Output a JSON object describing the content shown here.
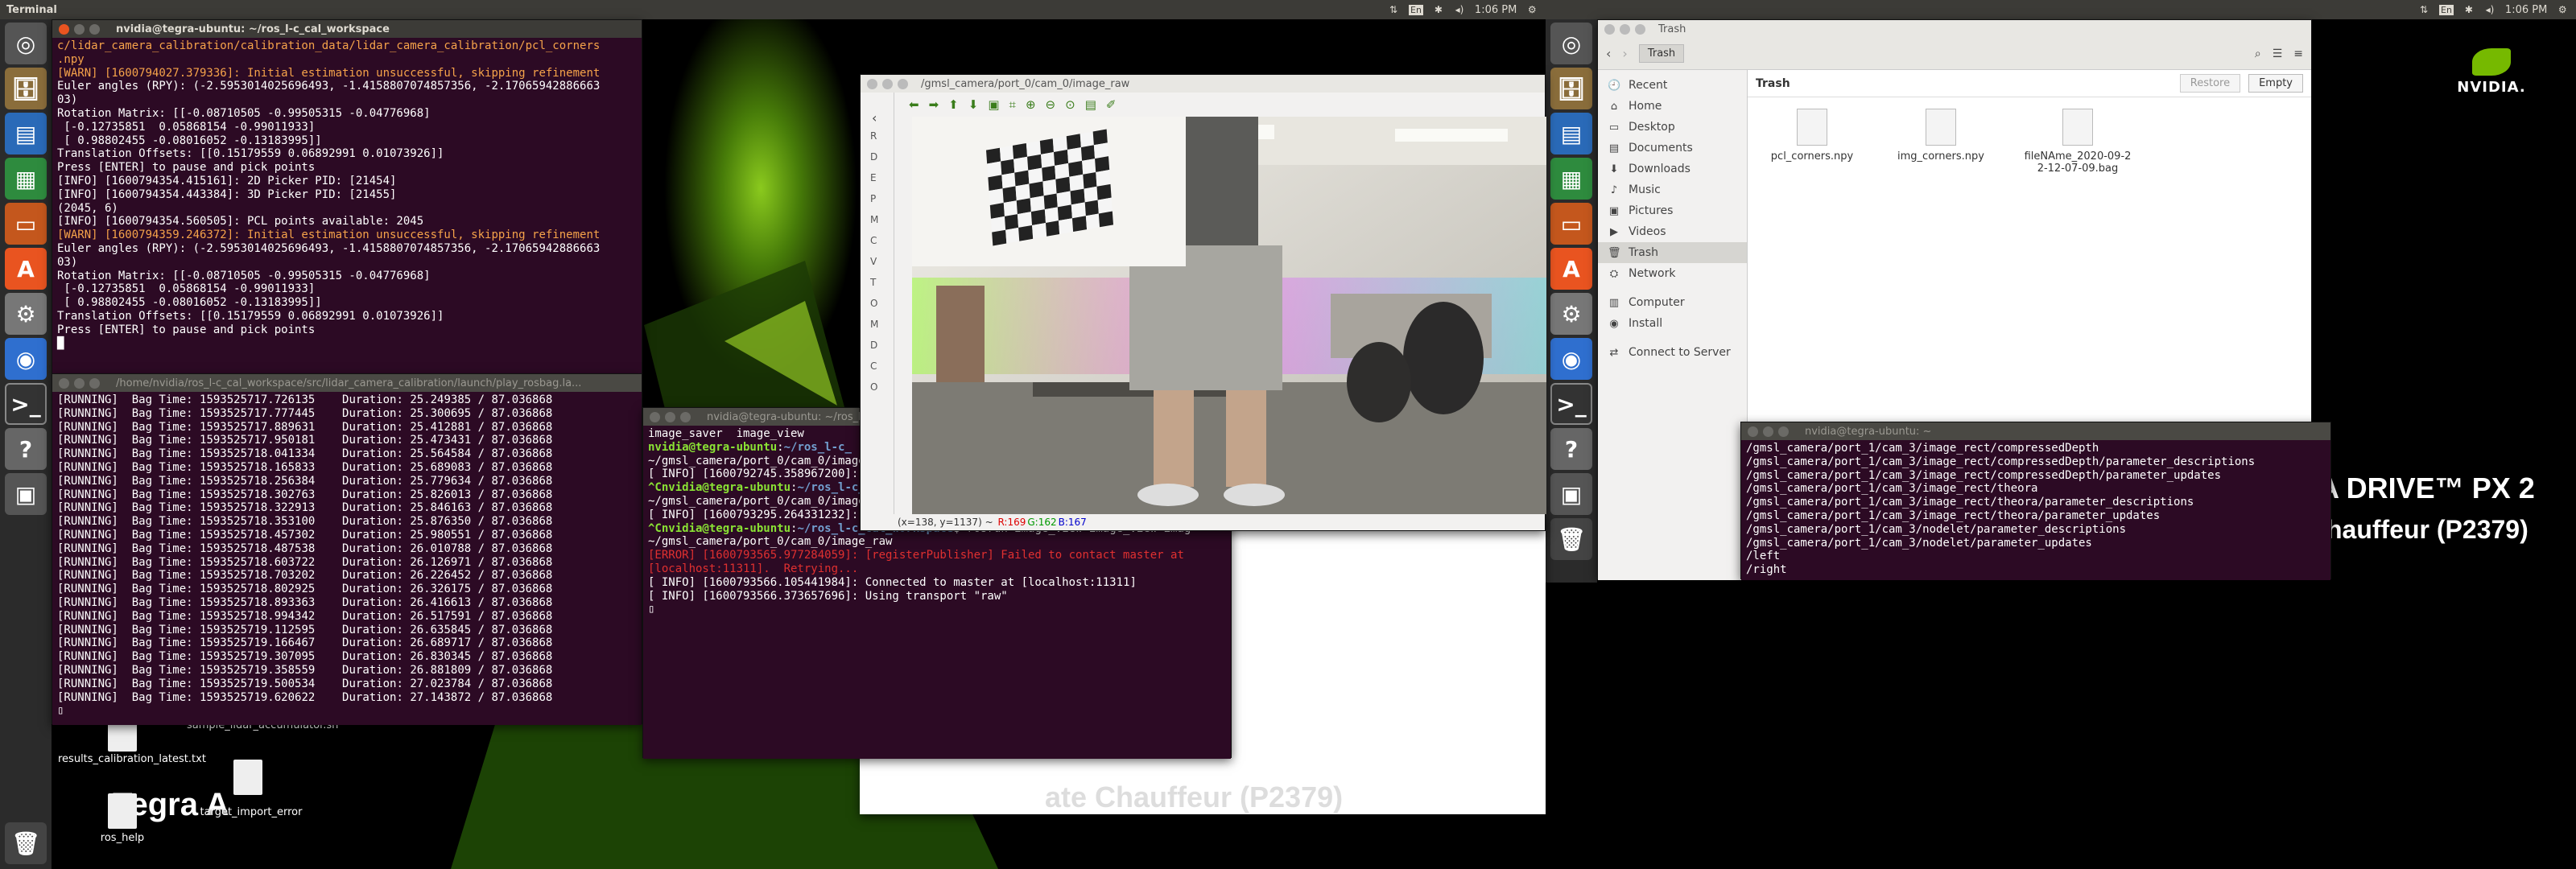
{
  "topbar_left": {
    "title": "Terminal",
    "time": "1:06 PM"
  },
  "topbar_right": {
    "time": "1:06 PM",
    "lang": "En"
  },
  "desktop": {
    "brand": "NVIDIA.",
    "drive_text": "IA DRIVE™ PX 2",
    "chauffeur_text": "hauffeur (P2379)",
    "tegra_text": "Tegra A",
    "icons": [
      {
        "label": "results_calibration_latest.txt"
      },
      {
        "label": "sample_lidar_accumulator.sh"
      },
      {
        "label": "ros_help"
      },
      {
        "label": "target_import_error"
      }
    ]
  },
  "term1": {
    "title": "nvidia@tegra-ubuntu: ~/ros_l-c_cal_workspace",
    "lines": [
      {
        "t": "c/lidar_camera_calibration/calibration_data/lidar_camera_calibration/pcl_corners",
        "c": "warn"
      },
      {
        "t": ".npy",
        "c": "warn"
      },
      {
        "t": "[WARN] [1600794027.379336]: Initial estimation unsuccessful, skipping refinement",
        "c": "warn"
      },
      {
        "t": "Euler angles (RPY): (-2.5953014025696493, -1.4158807074857356, -2.17065942886663",
        "c": ""
      },
      {
        "t": "03)",
        "c": ""
      },
      {
        "t": "Rotation Matrix: [[-0.08710505 -0.99505315 -0.04776968]",
        "c": ""
      },
      {
        "t": " [-0.12735851  0.05868154 -0.99011933]",
        "c": ""
      },
      {
        "t": " [ 0.98802455 -0.08016052 -0.13183995]]",
        "c": ""
      },
      {
        "t": "Translation Offsets: [[0.15179559 0.06892991 0.01073926]]",
        "c": ""
      },
      {
        "t": "Press [ENTER] to pause and pick points",
        "c": ""
      },
      {
        "t": "",
        "c": ""
      },
      {
        "t": "[INFO] [1600794354.415161]: 2D Picker PID: [21454]",
        "c": ""
      },
      {
        "t": "[INFO] [1600794354.443384]: 3D Picker PID: [21455]",
        "c": ""
      },
      {
        "t": "(2045, 6)",
        "c": ""
      },
      {
        "t": "[INFO] [1600794354.560505]: PCL points available: 2045",
        "c": ""
      },
      {
        "t": "[WARN] [1600794359.246372]: Initial estimation unsuccessful, skipping refinement",
        "c": "warn"
      },
      {
        "t": "Euler angles (RPY): (-2.5953014025696493, -1.4158807074857356, -2.17065942886663",
        "c": ""
      },
      {
        "t": "03)",
        "c": ""
      },
      {
        "t": "Rotation Matrix: [[-0.08710505 -0.99505315 -0.04776968]",
        "c": ""
      },
      {
        "t": " [-0.12735851  0.05868154 -0.99011933]",
        "c": ""
      },
      {
        "t": " [ 0.98802455 -0.08016052 -0.13183995]]",
        "c": ""
      },
      {
        "t": "Translation Offsets: [[0.15179559 0.06892991 0.01073926]]",
        "c": ""
      },
      {
        "t": "Press [ENTER] to pause and pick points",
        "c": ""
      }
    ]
  },
  "term2": {
    "title": "/home/nvidia/ros_l-c_cal_workspace/src/lidar_camera_calibration/launch/play_rosbag.la...",
    "lines": [
      {
        "time": "1593525717.726135",
        "dur": "25.249385"
      },
      {
        "time": "1593525717.777445",
        "dur": "25.300695"
      },
      {
        "time": "1593525717.889631",
        "dur": "25.412881"
      },
      {
        "time": "1593525717.950181",
        "dur": "25.473431"
      },
      {
        "time": "1593525718.041334",
        "dur": "25.564584"
      },
      {
        "time": "1593525718.165833",
        "dur": "25.689083"
      },
      {
        "time": "1593525718.256384",
        "dur": "25.779634"
      },
      {
        "time": "1593525718.302763",
        "dur": "25.826013"
      },
      {
        "time": "1593525718.322913",
        "dur": "25.846163"
      },
      {
        "time": "1593525718.353100",
        "dur": "25.876350"
      },
      {
        "time": "1593525718.457302",
        "dur": "25.980551"
      },
      {
        "time": "1593525718.487538",
        "dur": "26.010788"
      },
      {
        "time": "1593525718.603722",
        "dur": "26.126971"
      },
      {
        "time": "1593525718.703202",
        "dur": "26.226452"
      },
      {
        "time": "1593525718.802925",
        "dur": "26.326175"
      },
      {
        "time": "1593525718.893363",
        "dur": "26.416613"
      },
      {
        "time": "1593525718.994342",
        "dur": "26.517591"
      },
      {
        "time": "1593525719.112595",
        "dur": "26.635845"
      },
      {
        "time": "1593525719.166467",
        "dur": "26.689717"
      },
      {
        "time": "1593525719.307095",
        "dur": "26.830345"
      },
      {
        "time": "1593525719.358559",
        "dur": "26.881809"
      },
      {
        "time": "1593525719.500534",
        "dur": "27.023784"
      },
      {
        "time": "1593525719.620622",
        "dur": "27.143872"
      }
    ],
    "status": "[RUNNING]",
    "bag_label": "Bag Time:",
    "dur_label": "Duration:",
    "total": "87.036868"
  },
  "term3": {
    "title": "nvidia@tegra-ubuntu: ~/ros_l-c_",
    "lines": [
      {
        "t": "image_saver  image_view",
        "c": ""
      },
      {
        "p": "nvidia@tegra-ubuntu",
        "d": "~/ros_l-c_",
        "rest": "",
        "c": "prompt"
      },
      {
        "t": "~/gmsl_camera/port_0/cam_0/image_ra",
        "c": ""
      },
      {
        "t": "[ INFO] [1600792745.358967200]: Us",
        "c": ""
      },
      {
        "p": "^Cnvidia@tegra-ubuntu",
        "d": "~/ros_l-c_",
        "rest": "",
        "c": "prompt"
      },
      {
        "t": "~/gmsl_camera/port_0/cam_0/image_ra",
        "c": ""
      },
      {
        "t": "[ INFO] [1600793295.264331232]: Using transport \"raw\"",
        "c": ""
      },
      {
        "p": "^Cnvidia@tegra-ubuntu",
        "d": "~/ros_l-c_cal_workspace",
        "rest": "$ rosrun image_view image_view imag",
        "c": "prompt"
      },
      {
        "t": "~/gmsl_camera/port_0/cam_0/image_raw",
        "c": ""
      },
      {
        "t": "[ERROR] [1600793565.977284059]: [registerPublisher] Failed to contact master at",
        "c": "err"
      },
      {
        "t": "[localhost:11311].  Retrying...",
        "c": "err"
      },
      {
        "t": "[ INFO] [1600793566.105441984]: Connected to master at [localhost:11311]",
        "c": ""
      },
      {
        "t": "[ INFO] [1600793566.373657696]: Using transport \"raw\"",
        "c": ""
      }
    ]
  },
  "imageview": {
    "title": "/gmsl_camera/port_0/cam_0/image_raw",
    "status_pos": "(x=138, y=1137) ~ ",
    "status_r": "R:169",
    "status_g": "G:162",
    "status_b": "B:167",
    "side_letters": [
      "R",
      "D",
      "E",
      "P",
      "M",
      "C",
      "V",
      "T",
      "O",
      "M",
      "D",
      "C",
      "O"
    ]
  },
  "behind_text": "ate Chauffeur (P2379)",
  "files": {
    "title": "Trash",
    "path": "Trash",
    "header": "Trash",
    "restore": "Restore",
    "empty": "Empty",
    "sidebar": [
      "Recent",
      "Home",
      "Desktop",
      "Documents",
      "Downloads",
      "Music",
      "Pictures",
      "Videos",
      "Trash",
      "Network",
      "Computer",
      "Install",
      "Connect to Server"
    ],
    "items": [
      {
        "name": "pcl_corners.npy"
      },
      {
        "name": "img_corners.npy"
      },
      {
        "name": "fileNAme_2020-09-22-12-07-09.bag"
      }
    ]
  },
  "term4": {
    "title": "nvidia@tegra-ubuntu: ~",
    "lines": [
      "/gmsl_camera/port_1/cam_3/image_rect/compressedDepth",
      "/gmsl_camera/port_1/cam_3/image_rect/compressedDepth/parameter_descriptions",
      "/gmsl_camera/port_1/cam_3/image_rect/compressedDepth/parameter_updates",
      "/gmsl_camera/port_1/cam_3/image_rect/theora",
      "/gmsl_camera/port_1/cam_3/image_rect/theora/parameter_descriptions",
      "/gmsl_camera/port_1/cam_3/image_rect/theora/parameter_updates",
      "/gmsl_camera/port_1/cam_3/nodelet/parameter_descriptions",
      "/gmsl_camera/port_1/cam_3/nodelet/parameter_updates",
      "/left",
      "/right"
    ]
  },
  "colors": {
    "terminal_bg": "#2c0a24",
    "ubuntu_orange": "#e95420",
    "nvidia_green": "#76b900"
  }
}
